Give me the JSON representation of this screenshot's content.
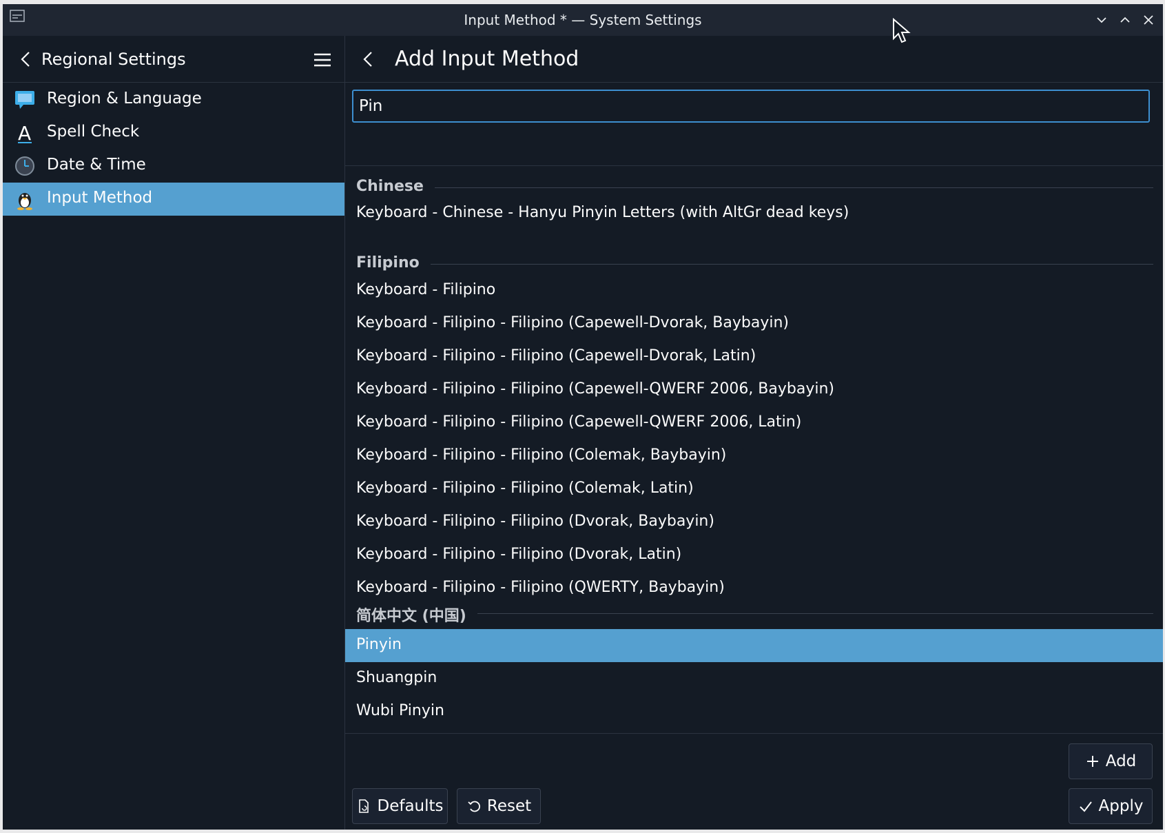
{
  "window": {
    "title": "Input Method * — System Settings"
  },
  "sidebar": {
    "header_title": "Regional Settings",
    "items": [
      {
        "label": "Region & Language",
        "icon": "region-language-icon"
      },
      {
        "label": "Spell Check",
        "icon": "spell-check-icon"
      },
      {
        "label": "Date & Time",
        "icon": "clock-icon"
      },
      {
        "label": "Input Method",
        "icon": "input-method-icon",
        "active": true
      }
    ]
  },
  "main": {
    "title": "Add Input Method",
    "search": {
      "value": "Pin"
    },
    "sections": [
      {
        "header": "Chinese",
        "items": [
          "Keyboard - Chinese - Hanyu Pinyin Letters (with AltGr dead keys)"
        ]
      },
      {
        "header": "Filipino",
        "items": [
          "Keyboard - Filipino",
          "Keyboard - Filipino - Filipino (Capewell-Dvorak, Baybayin)",
          "Keyboard - Filipino - Filipino (Capewell-Dvorak, Latin)",
          "Keyboard - Filipino - Filipino (Capewell-QWERF 2006, Baybayin)",
          "Keyboard - Filipino - Filipino (Capewell-QWERF 2006, Latin)",
          "Keyboard - Filipino - Filipino (Colemak, Baybayin)",
          "Keyboard - Filipino - Filipino (Colemak, Latin)",
          "Keyboard - Filipino - Filipino (Dvorak, Baybayin)",
          "Keyboard - Filipino - Filipino (Dvorak, Latin)",
          "Keyboard - Filipino - Filipino (QWERTY, Baybayin)"
        ]
      },
      {
        "header": "简体中文 (中国)",
        "items": [
          "Pinyin",
          "Shuangpin",
          "Wubi Pinyin"
        ],
        "selected": "Pinyin"
      }
    ],
    "buttons": {
      "add": "Add",
      "defaults": "Defaults",
      "reset": "Reset",
      "apply": "Apply"
    }
  },
  "colors": {
    "accent": "#55a0d0",
    "background": "#141b25",
    "titlebar": "#1f2632"
  }
}
